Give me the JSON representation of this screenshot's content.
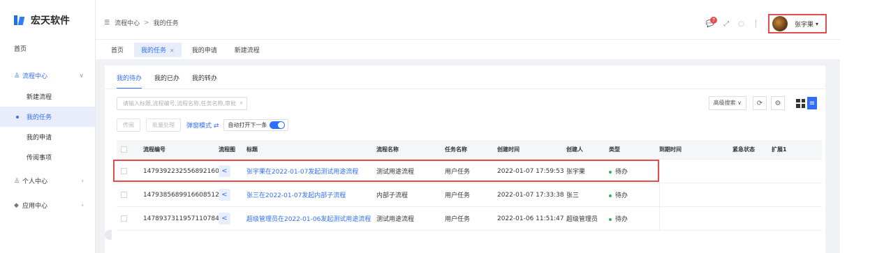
{
  "logo": {
    "text": "宏天软件"
  },
  "sidebar": {
    "home": "首页",
    "groups": [
      {
        "label": "流程中心",
        "icon": "user-icon"
      },
      {
        "label": "个人中心",
        "icon": "person-icon"
      },
      {
        "label": "应用中心",
        "icon": "stack-icon"
      }
    ],
    "sub_items": [
      {
        "label": "新建流程"
      },
      {
        "label": "我的任务"
      },
      {
        "label": "我的申请"
      },
      {
        "label": "传阅事项"
      }
    ]
  },
  "header": {
    "breadcrumb": [
      "流程中心",
      "我的任务"
    ],
    "notify_count": "7",
    "user_name": "张宇果"
  },
  "page_tabs": [
    "首页",
    "我的任务",
    "我的申请",
    "新建流程"
  ],
  "sub_tabs": [
    "我的待办",
    "我的已办",
    "我的转办"
  ],
  "search": {
    "placeholder": "请输入标题,流程编号,流程名称,任务名称,审批"
  },
  "toolbar": {
    "advanced": "高级搜索 ∨",
    "pass_btn": "传阅",
    "batch_btn": "批量处理",
    "popup_mode": "弹窗模式 ⇄",
    "auto_next": "自动打开下一条"
  },
  "table": {
    "headers": [
      "流程编号",
      "流程图",
      "标题",
      "流程名称",
      "任务名称",
      "创建时间",
      "创建人",
      "类型",
      "到期时间",
      "紧急状态",
      "扩展1"
    ],
    "rows": [
      {
        "id": "1479392232556892160",
        "title": "张宇果在2022-01-07发起测试用途流程",
        "flow": "测试用途流程",
        "task": "用户任务",
        "created": "2022-01-07 17:59:53",
        "creator": "张宇果",
        "type": "待办"
      },
      {
        "id": "1479385689916608512",
        "title": "张三在2022-01-07发起内部子流程",
        "flow": "内部子流程",
        "task": "用户任务",
        "created": "2022-01-07 17:33:38",
        "creator": "张三",
        "type": "待办"
      },
      {
        "id": "1478937311957110784",
        "title": "超级管理员在2022-01-06发起测试用途流程",
        "flow": "测试用途流程",
        "task": "用户任务",
        "created": "2022-01-06 11:51:47",
        "creator": "超级管理员",
        "type": "待办"
      }
    ]
  },
  "colors": {
    "accent": "#2f6ff5",
    "highlight": "#e24c4c",
    "status_green": "#37b15e"
  }
}
